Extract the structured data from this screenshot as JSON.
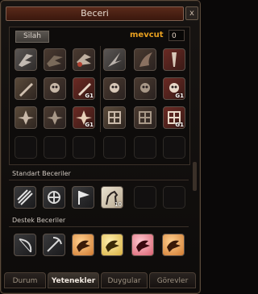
{
  "window": {
    "title": "Beceri",
    "close_label": "x"
  },
  "header": {
    "group_tab_label": "Silah",
    "points_label": "mevcut",
    "points_value": "0"
  },
  "grid": {
    "rows": [
      [
        "wing-icon",
        "wing-icon",
        "wing-icon",
        "wing-icon",
        "wing-icon",
        "wing-icon"
      ],
      [
        "sword-icon",
        "skull-icon",
        "sword-icon",
        "skull-icon",
        "skull-icon",
        "skull-icon"
      ],
      [
        "rune-icon",
        "rune-icon",
        "rune-icon",
        "rune-icon",
        "rune-icon",
        "rune-icon"
      ]
    ],
    "badges": {
      "g1": "G1"
    }
  },
  "sections": {
    "standard_title": "Standart Beceriler",
    "support_title": "Destek Beceriler"
  },
  "standard": {
    "level_badge": "10"
  },
  "tabs": [
    {
      "label": "Durum"
    },
    {
      "label": "Yetenekler"
    },
    {
      "label": "Duygular"
    },
    {
      "label": "Görevler"
    }
  ],
  "active_tab": "Yetenekler"
}
